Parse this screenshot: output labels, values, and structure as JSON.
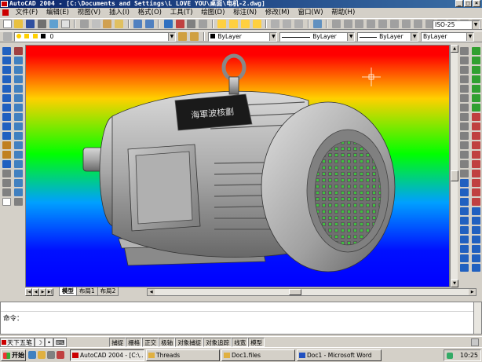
{
  "window": {
    "title": "AutoCAD 2004 - [C:\\Documents and Settings\\L LOVE YOU\\桌面\\电机-2.dwg]",
    "min": "_",
    "max": "□",
    "close": "×"
  },
  "menu": [
    "文件(F)",
    "编辑(E)",
    "视图(V)",
    "插入(I)",
    "格式(O)",
    "工具(T)",
    "绘图(D)",
    "标注(N)",
    "修改(M)",
    "窗口(W)",
    "帮助(H)"
  ],
  "toolbar2": {
    "layer": "0",
    "color": "ByLayer",
    "linetype": "ByLayer",
    "lineweight": "ByLayer",
    "plotstyle": "ByLayer",
    "dimstyle": "ISO-25"
  },
  "model": {
    "nameplate": "海軍波核劃"
  },
  "layout_tabs": [
    "模型",
    "布局1",
    "布局2"
  ],
  "command": {
    "prompt": "命令："
  },
  "ime": {
    "name": "天下五笔",
    "moon": "☽",
    "dot": "•",
    "keyboard": "⌨"
  },
  "status_buttons": [
    "捕捉",
    "栅格",
    "正交",
    "极轴",
    "对象捕捉",
    "对象追踪",
    "线宽",
    "模型"
  ],
  "taskbar": {
    "start": "开始",
    "items": [
      {
        "label": "AutoCAD 2004 - [C:\\..."
      },
      {
        "label": "Threads"
      },
      {
        "label": "Doc1.files"
      },
      {
        "label": "Doc1 - Microsoft Word"
      }
    ],
    "clock": "10:25"
  },
  "colors": {
    "accent": "#0a246a",
    "chrome": "#d4d0c8"
  }
}
